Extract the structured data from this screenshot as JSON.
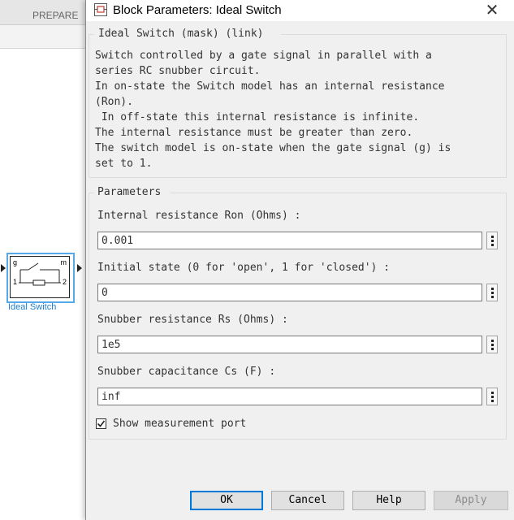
{
  "background": {
    "tab_label": "PREPARE",
    "block": {
      "port_g": "g",
      "port_m": "m",
      "port_1": "1",
      "port_2": "2",
      "label": "Ideal Switch"
    }
  },
  "dialog": {
    "title": "Block Parameters: Ideal Switch",
    "close_glyph": "✕",
    "mask_group": {
      "title": "Ideal Switch (mask) (link)",
      "description_lines": [
        "Switch controlled by a gate signal in parallel with a",
        "series RC snubber circuit.",
        "In on-state the Switch model has an internal resistance",
        "(Ron).",
        " In off-state this internal resistance is infinite.",
        "The internal resistance must be greater than zero.",
        "The switch model is on-state when the gate signal (g) is",
        "set to 1."
      ]
    },
    "parameters": {
      "title": "Parameters",
      "fields": [
        {
          "label": "Internal resistance Ron (Ohms) :",
          "value": "0.001"
        },
        {
          "label": "Initial state (0 for 'open', 1 for 'closed') :",
          "value": "0"
        },
        {
          "label": "Snubber resistance Rs (Ohms) :",
          "value": "1e5"
        },
        {
          "label": "Snubber capacitance Cs (F) :",
          "value": "inf"
        }
      ],
      "checkbox": {
        "label": "Show measurement port",
        "checked": true
      }
    },
    "buttons": {
      "ok": "OK",
      "cancel": "Cancel",
      "help": "Help",
      "apply": "Apply"
    }
  },
  "colors": {
    "accent": "#0078d7",
    "block_selection": "#54a9e8",
    "block_label": "#1c7fd1"
  }
}
